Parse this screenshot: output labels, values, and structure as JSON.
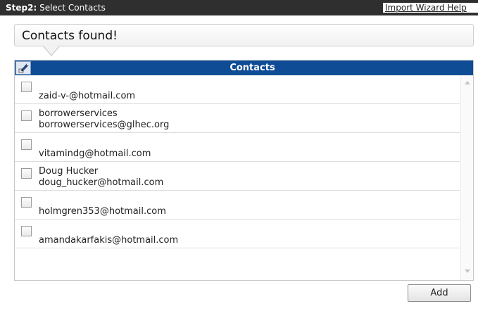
{
  "header": {
    "step_label": "Step2:",
    "step_text": "Select Contacts",
    "help_link": "Import Wizard Help"
  },
  "callout": {
    "title": "Contacts found!"
  },
  "table": {
    "column_header": "Contacts",
    "header_icon": "edit-icon",
    "rows": [
      {
        "line1": "",
        "line2": "zaid-v-@hotmail.com",
        "checked": false
      },
      {
        "line1": "borrowerservices",
        "line2": "borrowerservices@glhec.org",
        "checked": false
      },
      {
        "line1": "",
        "line2": "vitamindg@hotmail.com",
        "checked": false
      },
      {
        "line1": "Doug Hucker",
        "line2": "doug_hucker@hotmail.com",
        "checked": false
      },
      {
        "line1": "",
        "line2": "holmgren353@hotmail.com",
        "checked": false
      },
      {
        "line1": "",
        "line2": "amandakarfakis@hotmail.com",
        "checked": false
      }
    ]
  },
  "actions": {
    "add_label": "Add"
  },
  "colors": {
    "topbar": "#2f2f2f",
    "table_header": "#0f4c96"
  }
}
